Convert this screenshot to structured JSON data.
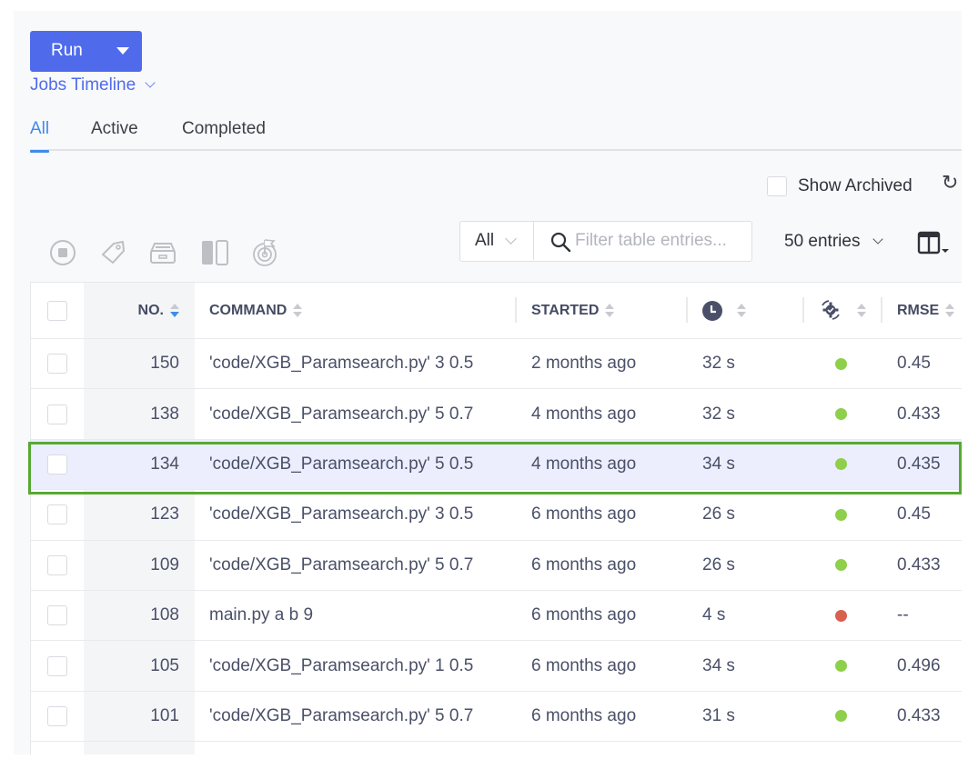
{
  "toolbar": {
    "run_label": "Run",
    "view_selector_label": "Jobs Timeline"
  },
  "tabs": [
    {
      "label": "All",
      "active": true
    },
    {
      "label": "Active",
      "active": false
    },
    {
      "label": "Completed",
      "active": false
    }
  ],
  "show_archived": {
    "label": "Show Archived",
    "checked": false
  },
  "actions": [
    "stop-icon",
    "tag-icon",
    "archive-icon",
    "compare-icon",
    "deploy-icon"
  ],
  "filter": {
    "scope_value": "All",
    "placeholder": "Filter table entries...",
    "value": ""
  },
  "entries_label": "50 entries",
  "table": {
    "columns": [
      {
        "key": "no",
        "label": "NO.",
        "sort": "desc"
      },
      {
        "key": "command",
        "label": "COMMAND",
        "sort": "none"
      },
      {
        "key": "started",
        "label": "STARTED",
        "sort": "none"
      },
      {
        "key": "duration",
        "label": "",
        "icon": "clock-icon",
        "sort": "none"
      },
      {
        "key": "status",
        "label": "",
        "icon": "status-gear-icon",
        "sort": "none"
      },
      {
        "key": "rmse",
        "label": "RMSE",
        "sort": "none"
      }
    ],
    "rows": [
      {
        "no": "150",
        "command": "'code/XGB_Paramsearch.py' 3 0.5",
        "started": "2 months ago",
        "duration": "32 s",
        "status": "success",
        "rmse": "0.45",
        "selected": false
      },
      {
        "no": "138",
        "command": "'code/XGB_Paramsearch.py' 5 0.7",
        "started": "4 months ago",
        "duration": "32 s",
        "status": "success",
        "rmse": "0.433",
        "selected": false
      },
      {
        "no": "134",
        "command": "'code/XGB_Paramsearch.py' 5 0.5",
        "started": "4 months ago",
        "duration": "34 s",
        "status": "success",
        "rmse": "0.435",
        "selected": true
      },
      {
        "no": "123",
        "command": "'code/XGB_Paramsearch.py' 3 0.5",
        "started": "6 months ago",
        "duration": "26 s",
        "status": "success",
        "rmse": "0.45",
        "selected": false
      },
      {
        "no": "109",
        "command": "'code/XGB_Paramsearch.py' 5 0.7",
        "started": "6 months ago",
        "duration": "26 s",
        "status": "success",
        "rmse": "0.433",
        "selected": false
      },
      {
        "no": "108",
        "command": "main.py a b 9",
        "started": "6 months ago",
        "duration": "4 s",
        "status": "failed",
        "rmse": "--",
        "selected": false
      },
      {
        "no": "105",
        "command": "'code/XGB_Paramsearch.py' 1 0.5",
        "started": "6 months ago",
        "duration": "34 s",
        "status": "success",
        "rmse": "0.496",
        "selected": false
      },
      {
        "no": "101",
        "command": "'code/XGB_Paramsearch.py' 5 0.7",
        "started": "6 months ago",
        "duration": "31 s",
        "status": "success",
        "rmse": "0.433",
        "selected": false
      }
    ]
  },
  "colors": {
    "accent": "#4f6bec",
    "tab_active": "#3f8be8",
    "status_success": "#8ed04b",
    "status_failed": "#d9604f",
    "selected_row_bg": "#eceefd",
    "highlight_border": "#56a932"
  }
}
